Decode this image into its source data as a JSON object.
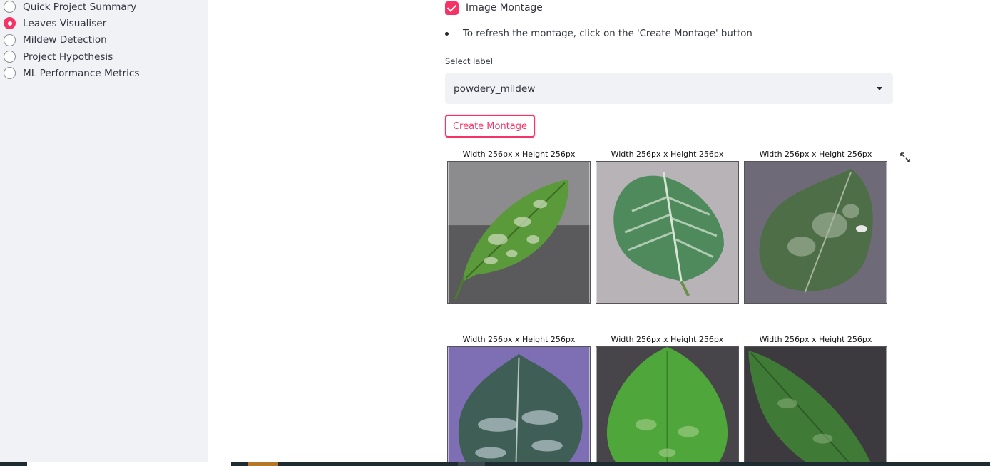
{
  "sidebar": {
    "items": [
      {
        "label": "Quick Project Summary",
        "selected": false
      },
      {
        "label": "Leaves Visualiser",
        "selected": true
      },
      {
        "label": "Mildew Detection",
        "selected": false
      },
      {
        "label": "Project Hypothesis",
        "selected": false
      },
      {
        "label": "ML Performance Metrics",
        "selected": false
      }
    ]
  },
  "main": {
    "checkbox": {
      "label": "Image Montage",
      "checked": true
    },
    "bullet": "To refresh the montage, click on the 'Create Montage' button",
    "select": {
      "label": "Select label",
      "value": "powdery_mildew"
    },
    "create_button": "Create Montage",
    "montage": {
      "titles": [
        "Width 256px x Height 256px",
        "Width 256px x Height 256px",
        "Width 256px x Height 256px",
        "Width 256px x Height 256px",
        "Width 256px x Height 256px",
        "Width 256px x Height 256px"
      ]
    }
  },
  "colors": {
    "accent": "#f63366",
    "sidebar_bg": "#f0f2f6",
    "select_bg": "#f0f2f6"
  }
}
